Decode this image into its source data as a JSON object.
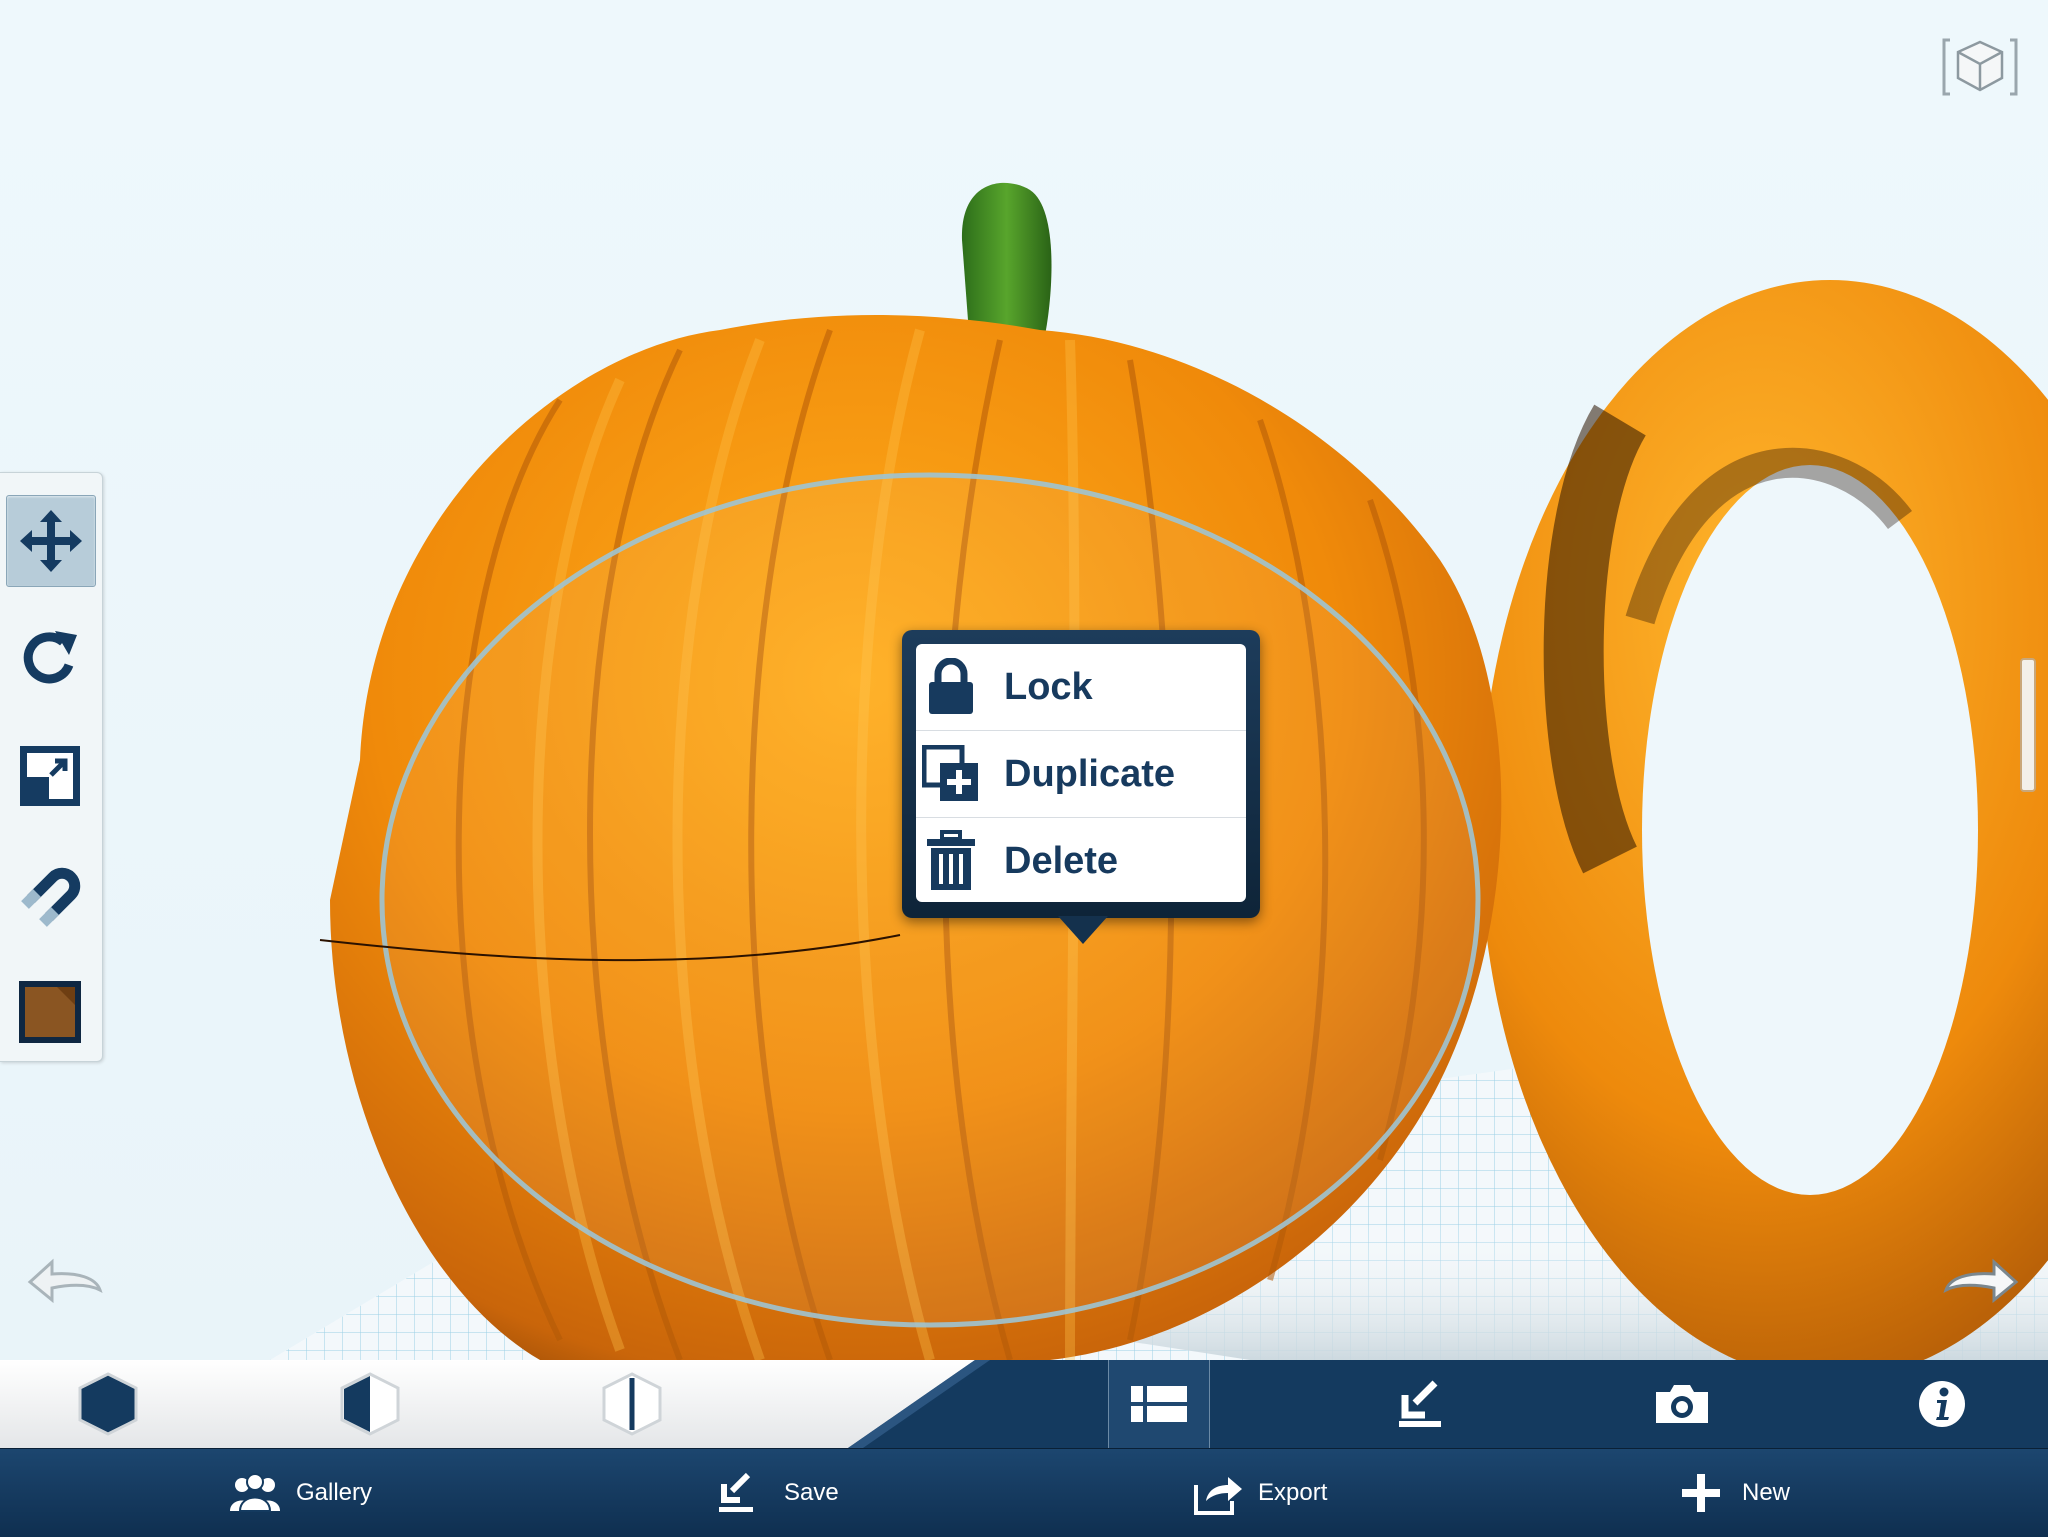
{
  "app": {
    "accent_color": "#173a5e",
    "object_color": "#f08a0a"
  },
  "view_cube": {
    "icon": "view-cube-icon"
  },
  "left_toolbar": {
    "tools": [
      {
        "name": "move",
        "icon": "move-icon",
        "active": true
      },
      {
        "name": "rotate",
        "icon": "rotate-icon",
        "active": false
      },
      {
        "name": "scale",
        "icon": "scale-icon",
        "active": false
      },
      {
        "name": "snap",
        "icon": "magnet-icon",
        "active": false
      },
      {
        "name": "material",
        "icon": "color-swatch-icon",
        "active": false,
        "swatch_color": "#8a5522"
      }
    ]
  },
  "context_menu": {
    "items": [
      {
        "label": "Lock",
        "icon": "lock-icon"
      },
      {
        "label": "Duplicate",
        "icon": "duplicate-icon"
      },
      {
        "label": "Delete",
        "icon": "trash-icon"
      }
    ]
  },
  "view_bar": {
    "buttons": [
      {
        "icon": "solid-view-icon"
      },
      {
        "icon": "half-view-icon"
      },
      {
        "icon": "outline-view-icon"
      },
      {
        "icon": "list-view-icon",
        "selected": true
      },
      {
        "icon": "download-icon"
      },
      {
        "icon": "camera-icon"
      },
      {
        "icon": "info-icon"
      }
    ]
  },
  "main_bar": {
    "gallery_label": "Gallery",
    "save_label": "Save",
    "export_label": "Export",
    "new_label": "New"
  }
}
